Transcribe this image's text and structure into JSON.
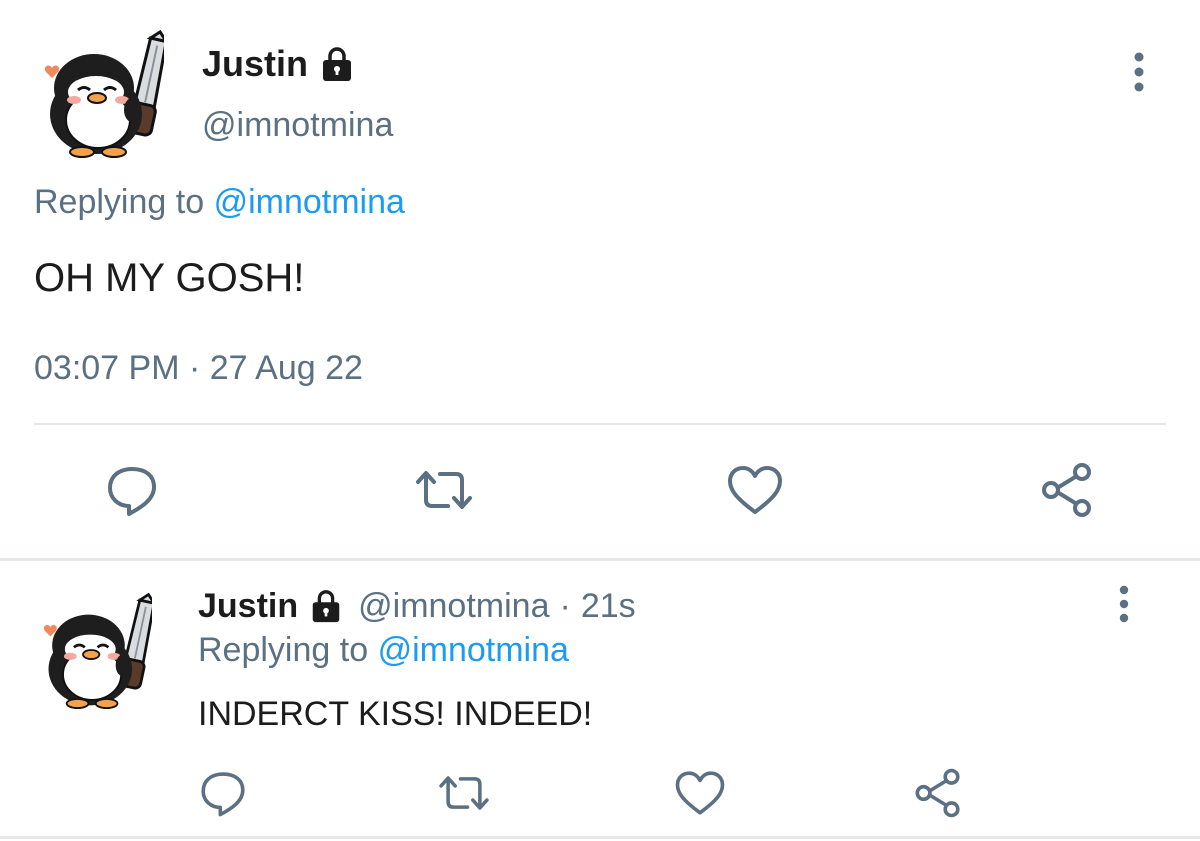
{
  "colors": {
    "name": "#1c1c1c",
    "secondary": "#5b7083",
    "mention": "#1d9bf0",
    "icon": "#5b7083",
    "divider": "#e3e6e9",
    "background": "#ffffff"
  },
  "main_tweet": {
    "display_name": "Justin",
    "lock_icon": "lock-icon",
    "handle": "@imnotmina",
    "replying_prefix": "Replying to",
    "replying_to": "@imnotmina",
    "text": "OH MY GOSH!",
    "time": "03:07 PM",
    "separator": "·",
    "date": "27 Aug 22",
    "actions": [
      "reply-icon",
      "retweet-icon",
      "like-icon",
      "share-icon"
    ]
  },
  "reply_tweet": {
    "display_name": "Justin",
    "lock_icon": "lock-icon",
    "handle": "@imnotmina",
    "separator": "·",
    "relative_time": "21s",
    "replying_prefix": "Replying to",
    "replying_to": "@imnotmina",
    "text": "INDERCT KISS! INDEED!",
    "actions": [
      "reply-icon",
      "retweet-icon",
      "like-icon",
      "share-icon"
    ]
  }
}
